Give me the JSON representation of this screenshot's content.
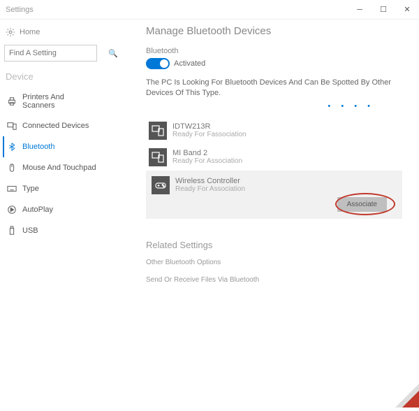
{
  "window": {
    "title": "Settings"
  },
  "sidebar": {
    "home": "Home",
    "search_placeholder": "Find A Setting",
    "section": "Device",
    "items": [
      {
        "label": "Printers And Scanners"
      },
      {
        "label": "Connected Devices"
      },
      {
        "label": "Bluetooth"
      },
      {
        "label": "Mouse And Touchpad"
      },
      {
        "label": "Type"
      },
      {
        "label": "AutoPlay"
      },
      {
        "label": "USB"
      }
    ]
  },
  "main": {
    "title": "Manage Bluetooth Devices",
    "bluetooth_label": "Bluetooth",
    "toggle_label": "Activated",
    "status_text": "The PC Is Looking For Bluetooth Devices And Can Be Spotted By Other Devices Of This Type.",
    "devices": [
      {
        "name": "IDTW213R",
        "status": "Ready For Fassociation"
      },
      {
        "name": "MI Band 2",
        "status": "Ready For Association"
      },
      {
        "name": "Wireless Controller",
        "status": "Ready For Association"
      }
    ],
    "associate_button": "Associate",
    "related_title": "Related Settings",
    "related_links": [
      "Other Bluetooth Options",
      "Send Or Receive Files Via Bluetooth"
    ]
  }
}
